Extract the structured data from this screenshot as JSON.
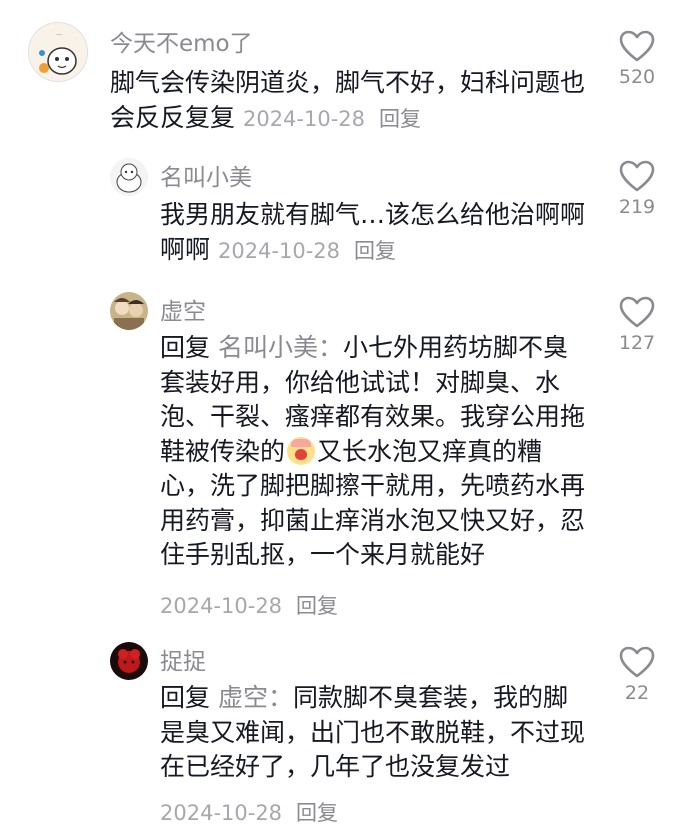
{
  "comments": [
    {
      "username": "今天不emo了",
      "text": "脚气会传染阴道炎，脚气不好，妇科问题也会反反复复",
      "date": "2024-10-28",
      "reply_label": "回复",
      "likes": "520"
    },
    {
      "username": "名叫小美",
      "text": "我男朋友就有脚气…该怎么给他治啊啊啊啊",
      "date": "2024-10-28",
      "reply_label": "回复",
      "likes": "219"
    },
    {
      "username": "虚空",
      "reply_prefix": "回复",
      "reply_target": "名叫小美：",
      "text_before_emoji": "小七外用药坊脚不臭套装好用，你给他试试！对脚臭、水泡、干裂、瘙痒都有效果。我穿公用拖鞋被传染的",
      "emoji_icon": "crying-face-emoji",
      "text_after_emoji": "又长水泡又痒真的糟心，洗了脚把脚擦干就用，先喷药水再用药膏，抑菌止痒消水泡又快又好，忍住手别乱抠，一个来月就能好",
      "date": "2024-10-28",
      "reply_label": "回复",
      "likes": "127"
    },
    {
      "username": "捉捉",
      "reply_prefix": "回复",
      "reply_target": "虚空：",
      "text": "同款脚不臭套装，我的脚是臭又难闻，出门也不敢脱鞋，不过现在已经好了，几年了也没复发过",
      "date": "2024-10-28",
      "reply_label": "回复",
      "likes": "22"
    }
  ],
  "icons": {
    "like": "heart-outline-icon"
  },
  "colors": {
    "text": "#161823",
    "secondary": "#8a8b91",
    "meta": "#a7a8ad",
    "heart": "#8a8b91"
  }
}
